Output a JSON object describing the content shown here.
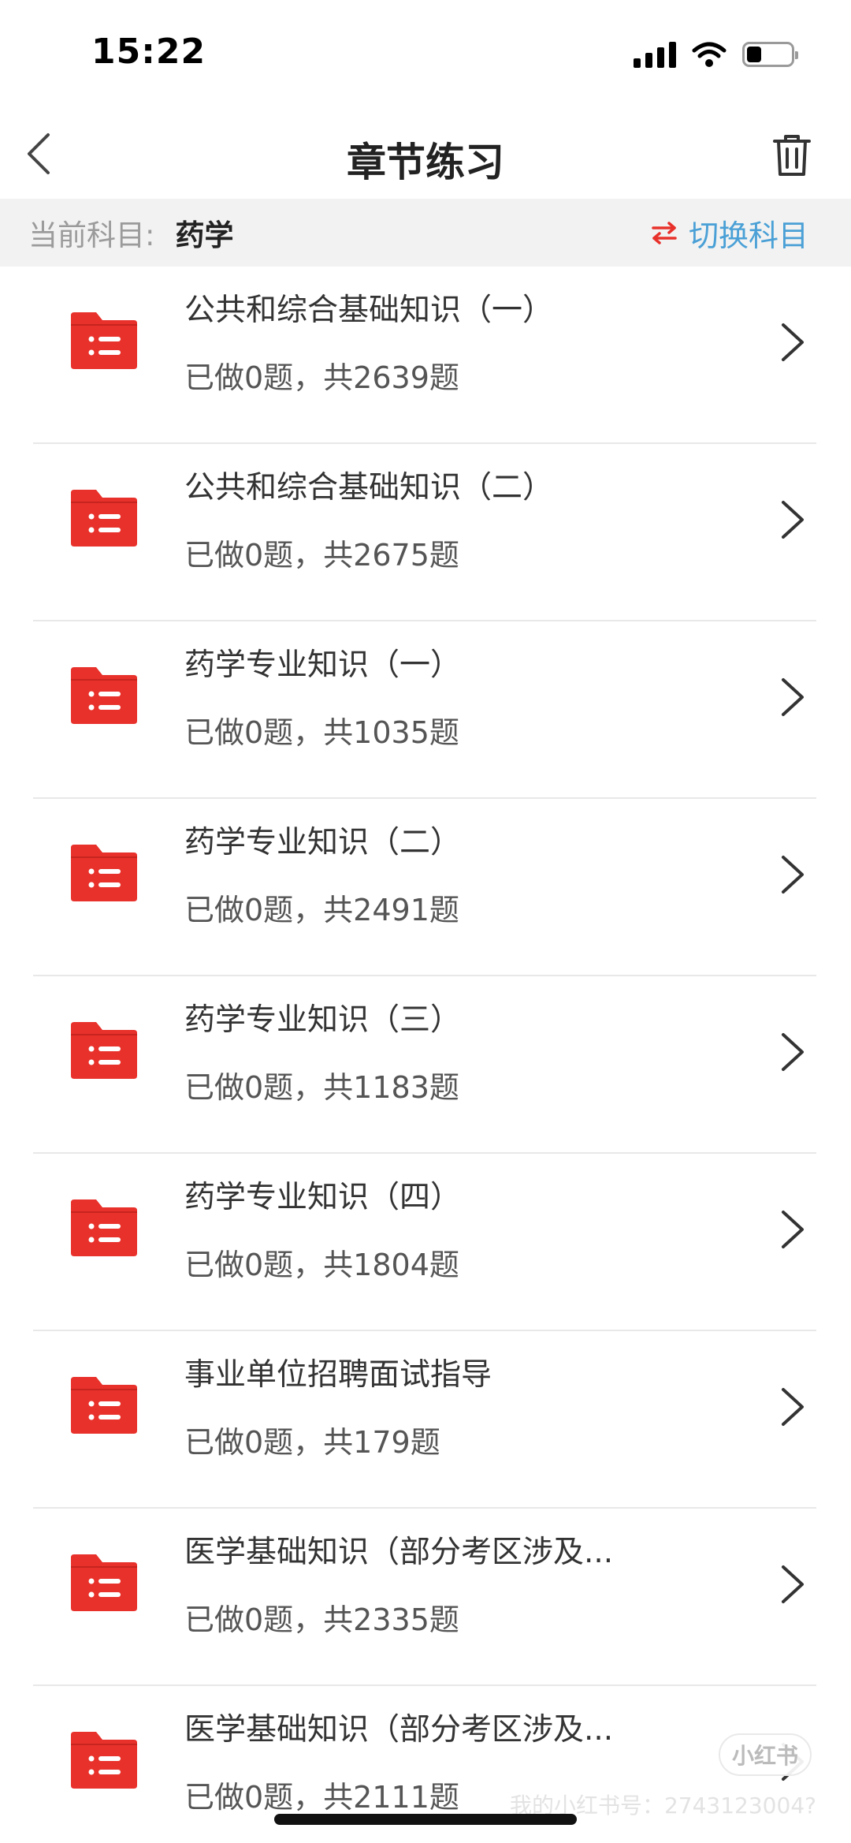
{
  "status_bar": {
    "time": "15:22"
  },
  "nav": {
    "title": "章节练习"
  },
  "subject": {
    "label": "当前科目:",
    "value": "药学",
    "switch_label": "切换科目"
  },
  "chapters": [
    {
      "title": "公共和综合基础知识（一）",
      "progress": "已做0题，共2639题"
    },
    {
      "title": "公共和综合基础知识（二）",
      "progress": "已做0题，共2675题"
    },
    {
      "title": "药学专业知识（一）",
      "progress": "已做0题，共1035题"
    },
    {
      "title": "药学专业知识（二）",
      "progress": "已做0题，共2491题"
    },
    {
      "title": "药学专业知识（三）",
      "progress": "已做0题，共1183题"
    },
    {
      "title": "药学专业知识（四）",
      "progress": "已做0题，共1804题"
    },
    {
      "title": "事业单位招聘面试指导",
      "progress": "已做0题，共179题"
    },
    {
      "title": "医学基础知识（部分考区涉及...",
      "progress": "已做0题，共2335题"
    },
    {
      "title": "医学基础知识（部分考区涉及...",
      "progress": "已做0题，共2111题"
    }
  ],
  "watermark": {
    "badge": "小红书",
    "text": "我的小红书号：2743123004?"
  },
  "colors": {
    "folder_red": "#e8312b",
    "switch_blue": "#4aa0d6",
    "switch_icon_red": "#e8312b"
  },
  "icons": {
    "back": "chevron-left-icon",
    "trash": "trash-icon",
    "switch": "switch-arrows-icon",
    "folder": "folder-list-icon",
    "chevron": "chevron-right-icon"
  }
}
